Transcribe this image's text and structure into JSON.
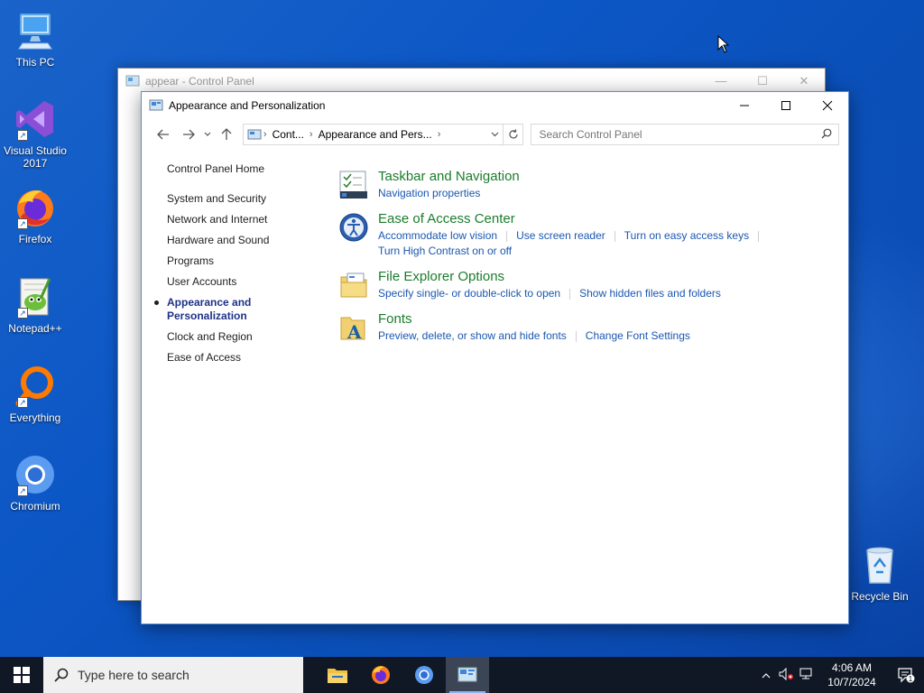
{
  "desktop": {
    "icons": [
      {
        "label": "This PC",
        "icon": "computer-icon"
      },
      {
        "label": "Visual Studio 2017",
        "icon": "visual-studio-icon"
      },
      {
        "label": "Firefox",
        "icon": "firefox-icon"
      },
      {
        "label": "Notepad++",
        "icon": "notepadpp-icon"
      },
      {
        "label": "Everything",
        "icon": "everything-icon"
      },
      {
        "label": "Chromium",
        "icon": "chromium-icon"
      },
      {
        "label": "Recycle Bin",
        "icon": "recycle-bin-icon"
      }
    ]
  },
  "back_window": {
    "title": "appear - Control Panel"
  },
  "window": {
    "title": "Appearance and Personalization",
    "breadcrumb": [
      "Cont...",
      "Appearance and Pers..."
    ],
    "search_placeholder": "Search Control Panel",
    "sidebar": {
      "home": "Control Panel Home",
      "items": [
        "System and Security",
        "Network and Internet",
        "Hardware and Sound",
        "Programs",
        "User Accounts",
        "Appearance and Personalization",
        "Clock and Region",
        "Ease of Access"
      ],
      "active_index": 5
    },
    "sections": [
      {
        "heading": "Taskbar and Navigation",
        "icon": "taskbar-icon",
        "links": [
          "Navigation properties"
        ]
      },
      {
        "heading": "Ease of Access Center",
        "icon": "ease-of-access-icon",
        "links": [
          "Accommodate low vision",
          "Use screen reader",
          "Turn on easy access keys",
          "Turn High Contrast on or off"
        ]
      },
      {
        "heading": "File Explorer Options",
        "icon": "folder-options-icon",
        "links": [
          "Specify single- or double-click to open",
          "Show hidden files and folders"
        ]
      },
      {
        "heading": "Fonts",
        "icon": "fonts-icon",
        "links": [
          "Preview, delete, or show and hide fonts",
          "Change Font Settings"
        ]
      }
    ]
  },
  "taskbar": {
    "search_placeholder": "Type here to search",
    "time": "4:06 AM",
    "date": "10/7/2024",
    "notification_count": "1"
  }
}
